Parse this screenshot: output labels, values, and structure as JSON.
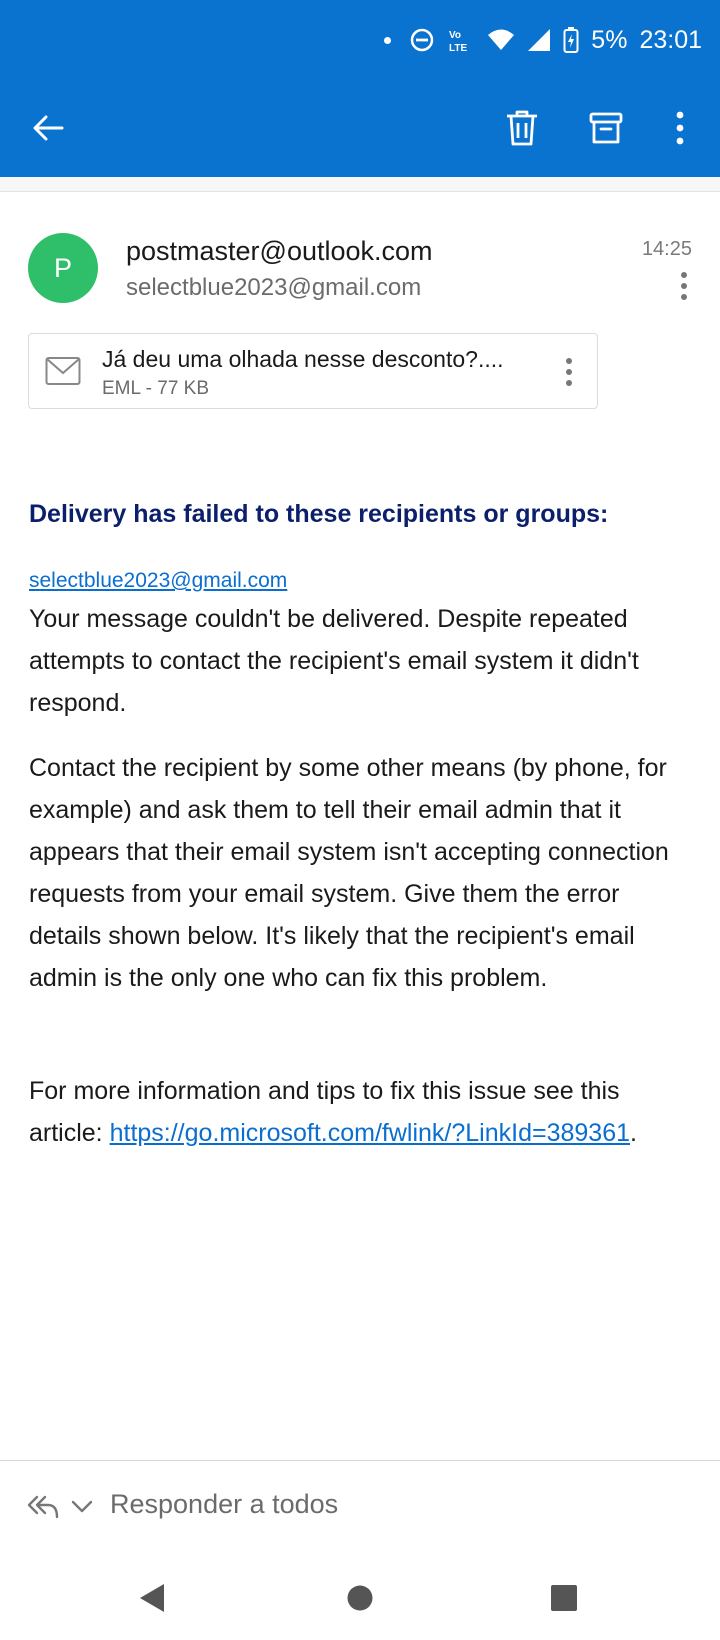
{
  "status_bar": {
    "time": "23:01",
    "battery": "5%",
    "network": "Vo LTE",
    "icons": [
      "dot-icon",
      "do-not-disturb-icon",
      "volte-icon",
      "wifi-icon",
      "signal-icon",
      "battery-charging-icon"
    ]
  },
  "app_bar": {
    "icons": [
      "back-arrow-icon",
      "trash-icon",
      "archive-icon",
      "more-vertical-icon"
    ]
  },
  "message": {
    "avatar_letter": "P",
    "sender": "postmaster@outlook.com",
    "recipient": "selectblue2023@gmail.com",
    "time": "14:25",
    "colors": {
      "avatar": "#2fbf6a",
      "link": "#0a6ed1",
      "heading": "#0b1f6b",
      "app_bar": "#0a72cf"
    }
  },
  "attachment": {
    "name": "Já deu uma olhada nesse desconto?....",
    "meta": "EML - 77 KB",
    "icon": "envelope-icon"
  },
  "body": {
    "heading": "Delivery has failed to these recipients or groups:",
    "recipient_link": "selectblue2023@gmail.com",
    "p1": "Your message couldn't be delivered. Despite repeated attempts to contact the recipient's email system it didn't respond.",
    "p2": "Contact the recipient by some other means (by phone, for example) and ask them to tell their email admin that it appears that their email system isn't accepting connection requests from your email system. Give them the error details shown below. It's likely that the recipient's email admin is the only one who can fix this problem.",
    "p3_prefix": "For more information and tips to fix this issue see this article: ",
    "p3_link": "https://go.microsoft.com/fwlink/?LinkId=389361",
    "p3_suffix": "."
  },
  "reply": {
    "label": "Responder a todos",
    "icons": [
      "reply-all-icon",
      "chevron-down-icon"
    ]
  },
  "nav_bar": {
    "icons": [
      "nav-back-icon",
      "nav-home-icon",
      "nav-recents-icon"
    ]
  }
}
